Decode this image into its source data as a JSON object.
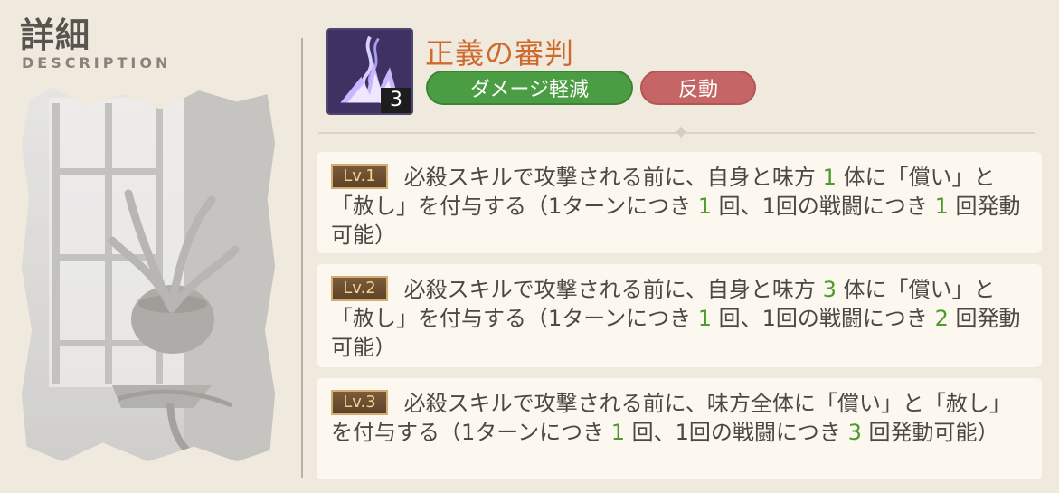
{
  "header": {
    "title": "詳細",
    "subtitle": "DESCRIPTION"
  },
  "skill": {
    "name": "正義の審判",
    "icon_level": "3",
    "tags": [
      {
        "label": "ダメージ軽減",
        "color": "#4b9d44"
      },
      {
        "label": "反動",
        "color": "#c56565"
      }
    ]
  },
  "levels": [
    {
      "badge": "Lv.1",
      "segments": [
        {
          "text": "必殺スキルで攻撃される前に、自身と味方",
          "highlight": false
        },
        {
          "text": "1",
          "highlight": true
        },
        {
          "text": "体に「償い」と「赦し」を付与する（1ターンにつき",
          "highlight": false
        },
        {
          "text": "1",
          "highlight": true
        },
        {
          "text": "回、1回の戦闘につき",
          "highlight": false
        },
        {
          "text": "1",
          "highlight": true
        },
        {
          "text": "回発動可能）",
          "highlight": false
        }
      ]
    },
    {
      "badge": "Lv.2",
      "segments": [
        {
          "text": "必殺スキルで攻撃される前に、自身と味方",
          "highlight": false
        },
        {
          "text": "3",
          "highlight": true
        },
        {
          "text": "体に「償い」と「赦し」を付与する（1ターンにつき",
          "highlight": false
        },
        {
          "text": "1",
          "highlight": true
        },
        {
          "text": "回、1回の戦闘につき",
          "highlight": false
        },
        {
          "text": "2",
          "highlight": true
        },
        {
          "text": "回発動可能）",
          "highlight": false
        }
      ]
    },
    {
      "badge": "Lv.3",
      "segments": [
        {
          "text": "必殺スキルで攻撃される前に、味方全体に「償い」と「赦し」を付与する（1ターンにつき",
          "highlight": false
        },
        {
          "text": "1",
          "highlight": true
        },
        {
          "text": "回、1回の戦闘につき",
          "highlight": false
        },
        {
          "text": "3",
          "highlight": true
        },
        {
          "text": "回発動可能）",
          "highlight": false
        }
      ]
    }
  ],
  "colors": {
    "background": "#efeadd",
    "card": "#fcf8ef",
    "skill_name": "#d06a2c",
    "highlight_number": "#4e9b2c"
  },
  "icons": {
    "skill_icon": "purple-crystal-skill-icon",
    "divider": "sparkle-divider-icon",
    "art": "window-plant-illustration"
  }
}
